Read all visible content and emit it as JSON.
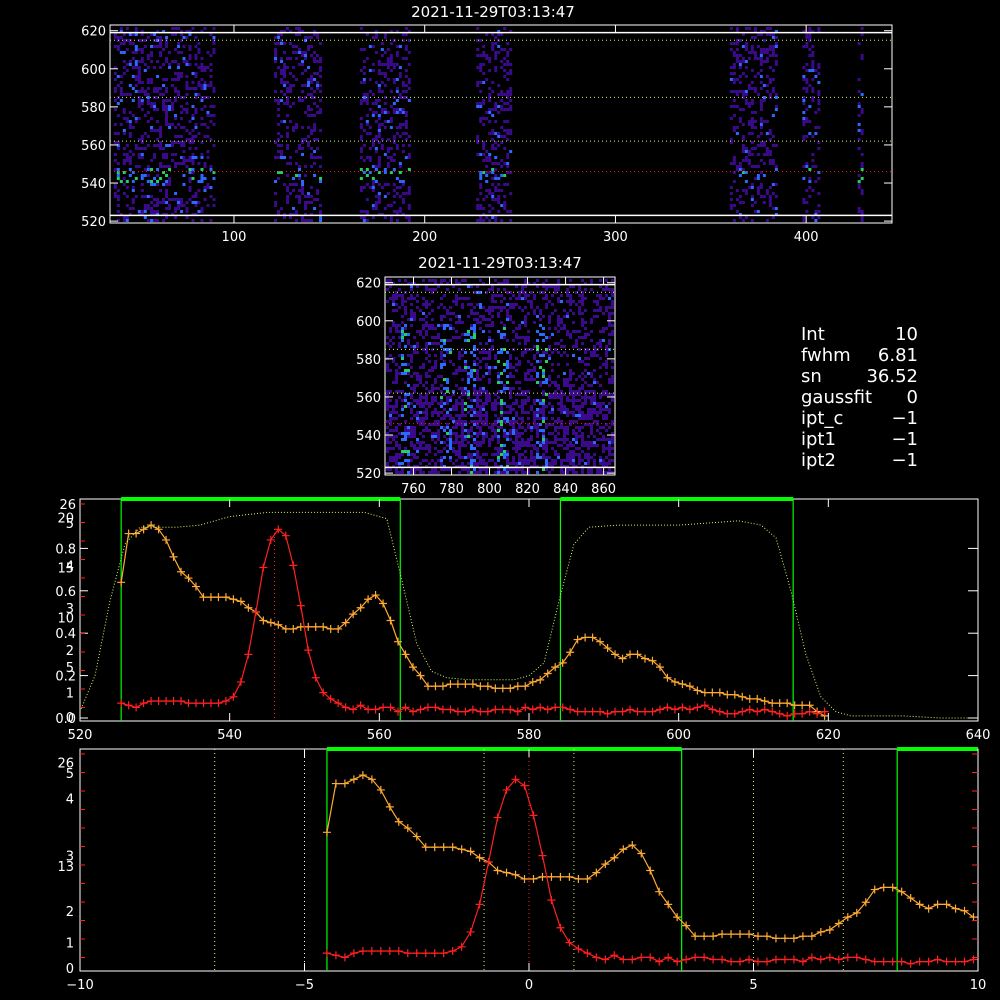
{
  "panels": {
    "top_title": "2021-11-29T03:13:47",
    "mid_title": "2021-11-29T03:13:47"
  },
  "info": {
    "rows": [
      {
        "label": "Int",
        "value": "10"
      },
      {
        "label": "fwhm",
        "value": "6.81"
      },
      {
        "label": "sn",
        "value": "36.52"
      },
      {
        "label": "gaussfit",
        "value": "0"
      },
      {
        "label": "ipt_c",
        "value": "−1"
      },
      {
        "label": "ipt1",
        "value": "−1"
      },
      {
        "label": "ipt2",
        "value": "−1"
      }
    ]
  },
  "colors": {
    "frame": "#ffffff",
    "green": "#00ff00",
    "yellow_dotted": "#ccff66",
    "orange": "#ffaa33",
    "red": "#ff2020",
    "heat_low": "#3a0a8a",
    "heat_mid": "#2a6aff",
    "heat_high": "#20d060"
  },
  "chart_data": [
    {
      "type": "heatmap",
      "title": "2021-11-29T03:13:47",
      "xlim": [
        35,
        445
      ],
      "ylim": [
        519,
        623
      ],
      "xticks": [
        100,
        200,
        300,
        400
      ],
      "yticks": [
        520,
        540,
        560,
        580,
        600,
        620
      ],
      "dotted_hlines": [
        615,
        585,
        562,
        546
      ],
      "solid_hlines": [
        619,
        523
      ],
      "bands": [
        {
          "x0": 37,
          "x1": 55
        },
        {
          "x0": 56,
          "x1": 72
        },
        {
          "x0": 73,
          "x1": 90
        },
        {
          "x0": 121,
          "x1": 146
        },
        {
          "x0": 166,
          "x1": 192
        },
        {
          "x0": 227,
          "x1": 245
        },
        {
          "x0": 360,
          "x1": 385
        },
        {
          "x0": 398,
          "x1": 406
        },
        {
          "x0": 427,
          "x1": 429
        }
      ]
    },
    {
      "type": "heatmap",
      "title": "2021-11-29T03:13:47",
      "xlim": [
        745,
        866
      ],
      "ylim": [
        519,
        623
      ],
      "xticks": [
        760,
        780,
        800,
        820,
        840,
        860
      ],
      "yticks": [
        520,
        540,
        560,
        580,
        600,
        620
      ],
      "dotted_hlines": [
        615,
        585,
        562,
        546
      ],
      "solid_hlines": [
        619,
        523
      ]
    },
    {
      "type": "line",
      "xlim": [
        520,
        640
      ],
      "xticks": [
        520,
        540,
        560,
        580,
        600,
        620,
        640
      ],
      "left_yticks_white": [
        "0.0",
        "0.2",
        "0.4",
        "0.6",
        "0.8"
      ],
      "left_yticks_red": [
        "0",
        "5",
        "10",
        "15",
        "20"
      ],
      "left_yticks_orange": [
        "1",
        "2",
        "3",
        "4",
        "5"
      ],
      "top_left_label": "26",
      "green_bars": [
        {
          "x0": 525.5,
          "x1": 562.8
        },
        {
          "x0": 584.2,
          "x1": 615.3
        }
      ],
      "series": [
        {
          "color": "orange",
          "x": [
            525.5,
            526.5,
            527.5,
            528.5,
            529.5,
            530.5,
            531.5,
            532.5,
            533.5,
            534.5,
            535.5,
            536.5,
            537.5,
            538.5,
            539.5,
            540.5,
            541.5,
            542.5,
            543.5,
            544.5,
            545.5,
            546.5,
            547.5,
            548.5,
            549.5,
            550.5,
            551.5,
            552.5,
            553.5,
            554.5,
            555.5,
            556.5,
            557.5,
            558.5,
            559.5,
            560.5,
            561.5,
            562.5,
            563.5,
            564.5,
            565.5,
            566.5,
            567.5,
            568.5,
            569.5,
            570.5,
            571.5,
            572.5,
            573.5,
            574.5,
            575.5,
            576.5,
            577.5,
            578.5,
            579.5,
            580.5,
            581.5,
            582.5,
            583.5,
            584.5,
            585.5,
            586.5,
            587.5,
            588.5,
            589.5,
            590.5,
            591.5,
            592.5,
            593.5,
            594.5,
            595.5,
            596.5,
            597.5,
            598.5,
            599.5,
            600.5,
            601.5,
            602.5,
            603.5,
            604.5,
            605.5,
            606.5,
            607.5,
            608.5,
            609.5,
            610.5,
            611.5,
            612.5,
            613.5,
            614.5,
            615.5,
            616.5,
            617.5,
            618.5,
            619.5
          ],
          "y": [
            0.64,
            0.87,
            0.87,
            0.89,
            0.91,
            0.89,
            0.84,
            0.76,
            0.69,
            0.66,
            0.62,
            0.57,
            0.57,
            0.57,
            0.57,
            0.56,
            0.55,
            0.52,
            0.5,
            0.46,
            0.45,
            0.44,
            0.42,
            0.42,
            0.43,
            0.43,
            0.43,
            0.43,
            0.42,
            0.42,
            0.45,
            0.49,
            0.52,
            0.56,
            0.58,
            0.54,
            0.46,
            0.36,
            0.3,
            0.24,
            0.2,
            0.15,
            0.15,
            0.15,
            0.16,
            0.16,
            0.16,
            0.16,
            0.15,
            0.15,
            0.14,
            0.14,
            0.14,
            0.15,
            0.15,
            0.17,
            0.18,
            0.21,
            0.24,
            0.26,
            0.31,
            0.37,
            0.38,
            0.38,
            0.36,
            0.33,
            0.3,
            0.28,
            0.3,
            0.3,
            0.28,
            0.27,
            0.24,
            0.19,
            0.17,
            0.16,
            0.15,
            0.13,
            0.12,
            0.12,
            0.12,
            0.11,
            0.11,
            0.1,
            0.09,
            0.09,
            0.08,
            0.07,
            0.07,
            0.07,
            0.06,
            0.06,
            0.06,
            0.03,
            0.01
          ]
        },
        {
          "color": "red",
          "x": [
            525.5,
            526.5,
            527.5,
            528.5,
            529.5,
            530.5,
            531.5,
            532.5,
            533.5,
            534.5,
            535.5,
            536.5,
            537.5,
            538.5,
            539.5,
            540.5,
            541.5,
            542.5,
            543.5,
            544.5,
            545.5,
            546.5,
            547.5,
            548.5,
            549.5,
            550.5,
            551.5,
            552.5,
            553.5,
            554.5,
            555.5,
            556.5,
            557.5,
            558.5,
            559.5,
            560.5,
            561.5,
            562.5,
            563.5,
            564.5,
            565.5,
            566.5,
            567.5,
            568.5,
            569.5,
            570.5,
            571.5,
            572.5,
            573.5,
            574.5,
            575.5,
            576.5,
            577.5,
            578.5,
            579.5,
            580.5,
            581.5,
            582.5,
            583.5,
            584.5,
            585.5,
            586.5,
            587.5,
            588.5,
            589.5,
            590.5,
            591.5,
            592.5,
            593.5,
            594.5,
            595.5,
            596.5,
            597.5,
            598.5,
            599.5,
            600.5,
            601.5,
            602.5,
            603.5,
            604.5,
            605.5,
            606.5,
            607.5,
            608.5,
            609.5,
            610.5,
            611.5,
            612.5,
            613.5,
            614.5,
            615.5,
            616.5,
            617.5,
            618.5,
            619.5
          ],
          "y": [
            0.07,
            0.06,
            0.05,
            0.07,
            0.08,
            0.08,
            0.08,
            0.08,
            0.08,
            0.07,
            0.07,
            0.07,
            0.07,
            0.07,
            0.08,
            0.1,
            0.17,
            0.3,
            0.5,
            0.71,
            0.84,
            0.89,
            0.86,
            0.72,
            0.53,
            0.32,
            0.19,
            0.12,
            0.09,
            0.07,
            0.05,
            0.04,
            0.06,
            0.04,
            0.04,
            0.05,
            0.05,
            0.03,
            0.05,
            0.03,
            0.04,
            0.05,
            0.05,
            0.04,
            0.04,
            0.03,
            0.03,
            0.04,
            0.03,
            0.03,
            0.04,
            0.04,
            0.04,
            0.03,
            0.05,
            0.04,
            0.05,
            0.04,
            0.05,
            0.05,
            0.04,
            0.03,
            0.03,
            0.03,
            0.03,
            0.02,
            0.03,
            0.03,
            0.04,
            0.03,
            0.03,
            0.03,
            0.04,
            0.05,
            0.04,
            0.05,
            0.04,
            0.05,
            0.06,
            0.04,
            0.03,
            0.02,
            0.02,
            0.03,
            0.04,
            0.03,
            0.04,
            0.03,
            0.02,
            0.01,
            0.02,
            0.02,
            0.03,
            0.02,
            0.03
          ]
        },
        {
          "color": "yellow_dotted",
          "x": [
            520,
            522,
            524,
            526,
            528,
            530,
            533,
            536,
            540,
            545,
            550,
            555,
            558,
            561,
            563,
            565,
            567,
            569,
            572,
            575,
            578,
            580,
            582,
            584,
            586,
            588,
            592,
            596,
            600,
            604,
            608,
            611,
            613,
            615,
            617,
            619,
            621,
            623,
            626,
            630,
            635,
            640
          ],
          "y": [
            0.03,
            0.2,
            0.55,
            0.82,
            0.9,
            0.9,
            0.9,
            0.91,
            0.95,
            0.97,
            0.97,
            0.97,
            0.97,
            0.94,
            0.65,
            0.35,
            0.22,
            0.19,
            0.18,
            0.18,
            0.18,
            0.2,
            0.26,
            0.55,
            0.82,
            0.9,
            0.91,
            0.91,
            0.91,
            0.92,
            0.93,
            0.91,
            0.85,
            0.6,
            0.3,
            0.1,
            0.03,
            0.01,
            0.01,
            0.01,
            0.0,
            0.0
          ]
        }
      ]
    },
    {
      "type": "line",
      "xlim": [
        -10,
        10
      ],
      "xticks": [
        -10,
        -5,
        0,
        5,
        10
      ],
      "left_yticks_orange": [
        "1",
        "2",
        "3",
        "4",
        "5"
      ],
      "left_yticks_red": [
        "0",
        "13",
        "26"
      ],
      "green_bars": [
        {
          "x0": -4.5,
          "x1": 3.4
        },
        {
          "x0": 8.2,
          "x1": 10.0
        }
      ],
      "series": [
        {
          "color": "orange",
          "x": [
            -4.5,
            -4.3,
            -4.1,
            -3.9,
            -3.7,
            -3.5,
            -3.3,
            -3.1,
            -2.9,
            -2.7,
            -2.5,
            -2.3,
            -2.1,
            -1.9,
            -1.7,
            -1.5,
            -1.3,
            -1.1,
            -0.9,
            -0.7,
            -0.5,
            -0.3,
            -0.1,
            0.1,
            0.3,
            0.5,
            0.7,
            0.9,
            1.1,
            1.3,
            1.5,
            1.7,
            1.9,
            2.1,
            2.3,
            2.5,
            2.7,
            2.9,
            3.1,
            3.3,
            3.5,
            3.7,
            3.9,
            4.1,
            4.3,
            4.5,
            4.7,
            4.9,
            5.1,
            5.3,
            5.5,
            5.7,
            5.9,
            6.1,
            6.3,
            6.5,
            6.7,
            6.9,
            7.1,
            7.3,
            7.5,
            7.7,
            7.9,
            8.1,
            8.3,
            8.5,
            8.7,
            8.9,
            9.1,
            9.3,
            9.5,
            9.7,
            9.9
          ],
          "y": [
            0.64,
            0.87,
            0.87,
            0.89,
            0.91,
            0.89,
            0.84,
            0.76,
            0.69,
            0.66,
            0.62,
            0.57,
            0.57,
            0.57,
            0.57,
            0.56,
            0.55,
            0.52,
            0.5,
            0.46,
            0.45,
            0.44,
            0.42,
            0.42,
            0.43,
            0.43,
            0.43,
            0.43,
            0.42,
            0.42,
            0.45,
            0.49,
            0.52,
            0.56,
            0.58,
            0.54,
            0.46,
            0.36,
            0.3,
            0.24,
            0.2,
            0.15,
            0.15,
            0.15,
            0.16,
            0.16,
            0.16,
            0.16,
            0.15,
            0.15,
            0.14,
            0.14,
            0.14,
            0.15,
            0.15,
            0.17,
            0.18,
            0.21,
            0.24,
            0.26,
            0.31,
            0.37,
            0.38,
            0.38,
            0.36,
            0.33,
            0.3,
            0.28,
            0.3,
            0.3,
            0.28,
            0.27,
            0.24
          ]
        },
        {
          "color": "red",
          "x": [
            -4.5,
            -4.3,
            -4.1,
            -3.9,
            -3.7,
            -3.5,
            -3.3,
            -3.1,
            -2.9,
            -2.7,
            -2.5,
            -2.3,
            -2.1,
            -1.9,
            -1.7,
            -1.5,
            -1.3,
            -1.1,
            -0.9,
            -0.7,
            -0.5,
            -0.3,
            -0.1,
            0.1,
            0.3,
            0.5,
            0.7,
            0.9,
            1.1,
            1.3,
            1.5,
            1.7,
            1.9,
            2.1,
            2.3,
            2.5,
            2.7,
            2.9,
            3.1,
            3.3,
            3.5,
            3.7,
            3.9,
            4.1,
            4.3,
            4.5,
            4.7,
            4.9,
            5.1,
            5.3,
            5.5,
            5.7,
            5.9,
            6.1,
            6.3,
            6.5,
            6.7,
            6.9,
            7.1,
            7.3,
            7.5,
            7.7,
            7.9,
            8.1,
            8.3,
            8.5,
            8.7,
            8.9,
            9.1,
            9.3,
            9.5,
            9.7,
            9.9
          ],
          "y": [
            0.07,
            0.06,
            0.05,
            0.07,
            0.08,
            0.08,
            0.08,
            0.08,
            0.08,
            0.07,
            0.07,
            0.07,
            0.07,
            0.07,
            0.08,
            0.1,
            0.17,
            0.3,
            0.5,
            0.71,
            0.84,
            0.89,
            0.86,
            0.72,
            0.53,
            0.32,
            0.19,
            0.12,
            0.09,
            0.07,
            0.05,
            0.04,
            0.06,
            0.04,
            0.04,
            0.05,
            0.05,
            0.03,
            0.05,
            0.03,
            0.04,
            0.05,
            0.05,
            0.04,
            0.04,
            0.03,
            0.03,
            0.04,
            0.03,
            0.03,
            0.04,
            0.04,
            0.04,
            0.03,
            0.05,
            0.04,
            0.05,
            0.04,
            0.05,
            0.05,
            0.04,
            0.03,
            0.03,
            0.03,
            0.03,
            0.02,
            0.03,
            0.03,
            0.04,
            0.03,
            0.03,
            0.03,
            0.04
          ]
        }
      ],
      "dotted_vlines": [
        {
          "x": -7,
          "color": "yellow_dotted"
        },
        {
          "x": -5,
          "color": "frame"
        },
        {
          "x": -1,
          "color": "yellow_dotted"
        },
        {
          "x": 0,
          "color": "red"
        },
        {
          "x": 1,
          "color": "yellow_dotted"
        },
        {
          "x": 5,
          "color": "yellow_dotted"
        },
        {
          "x": 7,
          "color": "yellow_dotted"
        }
      ]
    }
  ]
}
